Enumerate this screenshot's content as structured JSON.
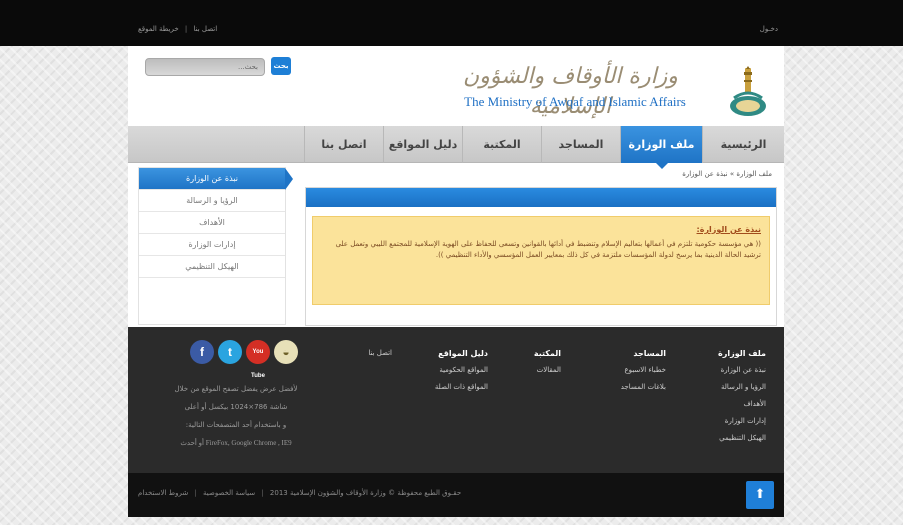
{
  "topbar": {
    "contact": "اتصل بنا",
    "separator": "|",
    "sitemap": "خريطة الموقع",
    "login": "دخـول"
  },
  "header": {
    "search_placeholder": "بحث...",
    "search_button": "بحث",
    "logo_arabic": "وزارة الأوقاف والشؤون الإسلامية",
    "logo_english": "The Ministry of Awqaf and Islamic Affairs"
  },
  "nav": {
    "items": [
      "الرئيسية",
      "ملف الوزارة",
      "المساجد",
      "المكتبة",
      "دليل المواقع",
      "اتصل بنا"
    ],
    "active": "ملف الوزارة"
  },
  "sidebar": {
    "items": [
      "نبذة عن الوزارة",
      "الرؤيا و الرسالة",
      "الأهداف",
      "إدارات الوزارة",
      "الهيكل التنظيمي"
    ],
    "active": "نبذة عن الوزارة"
  },
  "breadcrumb": {
    "parent": "ملف الوزارة",
    "arrow": "»",
    "current": "نبذة عن الوزارة"
  },
  "content": {
    "heading": "نبذة عن الوزارة:",
    "body": "(( هي مؤسسة حكومية تلتزم في أعمالها بتعاليم الإسلام وتنضبط في أدائها بالقوانين وتسعى للحفاظ على الهوية الإسلامية للمجتمع الليبي وتعمل على ترشيد الحالة الدينية بما يرسخ لدولة المؤسسات ملتزمة في كل ذلك بمعايير العمل المؤسسي والأداء التنظيمي ))."
  },
  "footer": {
    "columns": [
      {
        "heading": "ملف الوزارة",
        "items": [
          "نبذة عن الوزارة",
          "الرؤيا و الرسالة",
          "الأهداف",
          "إدارات الوزارة",
          "الهيكل التنظيمي"
        ]
      },
      {
        "heading": "المساجد",
        "items": [
          "خطباء الاسبوع",
          "بلاغات المساجد"
        ]
      },
      {
        "heading": "المكتبة",
        "items": [
          "المقالات"
        ]
      },
      {
        "heading": "دليل المواقع",
        "items": [
          "المواقع الحكومية",
          "المواقع ذات الصلة"
        ]
      },
      {
        "heading": "اتصل بنا",
        "items": []
      }
    ],
    "social": {
      "facebook": "f",
      "twitter": "t",
      "youtube": "You Tube",
      "other": "◒"
    },
    "browser_note": {
      "line1": "لأفضل عرض يفضل تصفح الموقع من خلال",
      "line2": "شاشة 786×1024 بيكسل أو أعلى",
      "line3": "و باستخدام أحد المتصفحات التالية:",
      "line4": "FireFox, Google Chrome , IE9 أو أحدث"
    }
  },
  "bottombar": {
    "copyright": "حقـوق الطبع محفوظة © وزارة الأوقاف والشؤون الإسلامية 2013",
    "privacy": "سياسة الخصوصية",
    "terms": "شروط الاستخدام",
    "separator": "|",
    "to_top": "⬆"
  }
}
